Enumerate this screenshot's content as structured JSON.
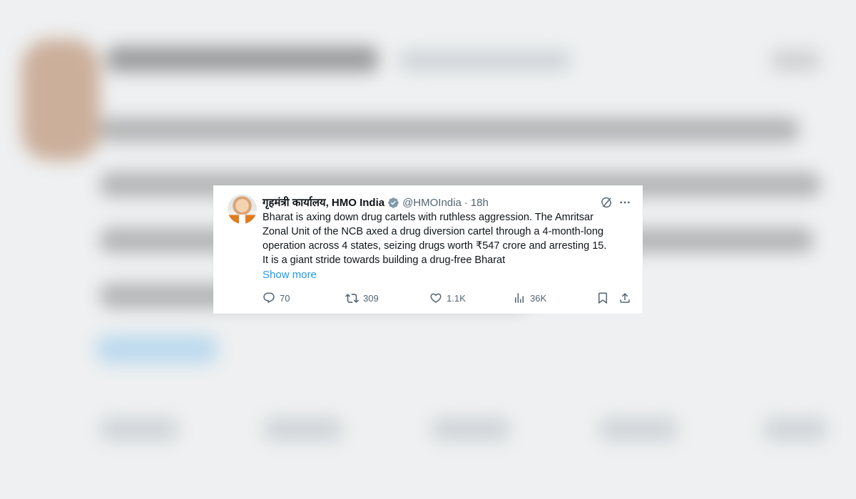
{
  "tweet": {
    "display_name": "गृहमंत्री कार्यालय, HMO India",
    "verified_icon": "verified-badge-icon",
    "handle": "@HMOIndia",
    "separator": "·",
    "time": "18h",
    "text_lines": [
      "Bharat is axing down drug cartels with ruthless aggression. The Amritsar",
      "Zonal Unit of the NCB axed a drug diversion cartel through a 4-month-long",
      "operation across 4 states, seizing drugs worth ₹547 crore and arresting 15.",
      "It is a giant stride towards building a drug-free Bharat"
    ],
    "show_more": "Show more",
    "stats": {
      "replies": "70",
      "reposts": "309",
      "likes": "1.1K",
      "views": "36K"
    }
  },
  "colors": {
    "text_primary": "#0f1419",
    "text_secondary": "#536471",
    "link": "#1d9bf0",
    "verified": "#829aab"
  },
  "icons": {
    "grok": "grok-icon",
    "more": "more-options-icon",
    "reply": "reply-icon",
    "repost": "repost-icon",
    "like": "heart-icon",
    "views": "views-icon",
    "bookmark": "bookmark-icon",
    "share": "share-icon"
  }
}
